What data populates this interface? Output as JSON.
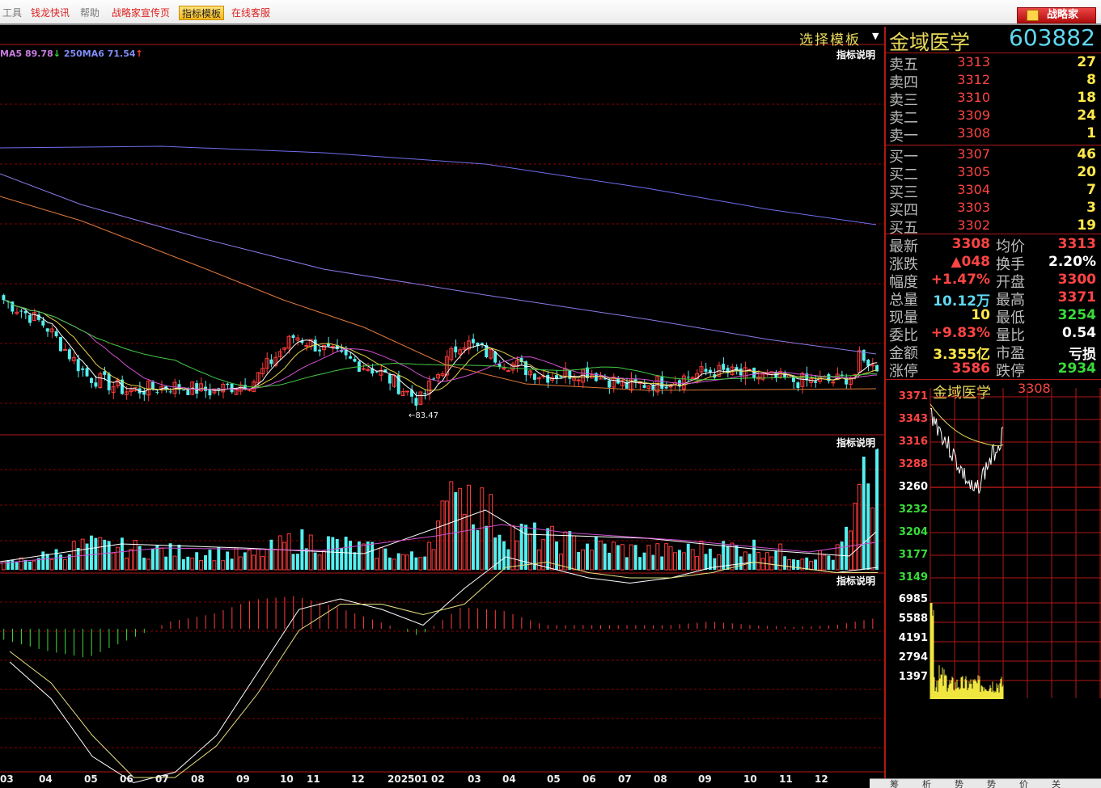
{
  "menu": {
    "tools": "工具",
    "news": "钱龙快讯",
    "help": "帮助",
    "promo": "战略家宣传页",
    "template": "指标模板",
    "service": "在线客服",
    "brand": "战略家"
  },
  "chart": {
    "template_select": "选择模板",
    "indicator_hint": "指标说明",
    "ma_legend": {
      "ma5_label": "MA5 89.78",
      "ma5_arrow": "↓",
      "ma6_label": "250MA6 71.54",
      "ma6_arrow": "↑"
    },
    "low_marker": "83.47",
    "x_labels": [
      "03",
      "04",
      "05",
      "06",
      "07",
      "08",
      "09",
      "10",
      "11",
      "12",
      "202501",
      "02",
      "03",
      "04",
      "05",
      "06",
      "07",
      "08",
      "09",
      "10",
      "11",
      "12"
    ]
  },
  "chart_data": [
    {
      "type": "candlestick",
      "title": "",
      "period": "daily",
      "x": [
        "03",
        "04",
        "05",
        "06",
        "07",
        "08",
        "09",
        "10",
        "11",
        "12",
        "202501",
        "02",
        "03",
        "04",
        "05",
        "06",
        "07",
        "08",
        "09",
        "10",
        "11",
        "12"
      ],
      "ohlc_approx": [
        {
          "x": "03",
          "open": 110,
          "high": 118,
          "low": 103,
          "close": 105
        },
        {
          "x": "04",
          "open": 105,
          "high": 108,
          "low": 95,
          "close": 100
        },
        {
          "x": "05",
          "open": 98,
          "high": 100,
          "low": 88,
          "close": 90
        },
        {
          "x": "06",
          "open": 90,
          "high": 93,
          "low": 86,
          "close": 87
        },
        {
          "x": "07",
          "open": 87,
          "high": 90,
          "low": 85,
          "close": 88
        },
        {
          "x": "08",
          "open": 88,
          "high": 90,
          "low": 86,
          "close": 87
        },
        {
          "x": "09",
          "open": 87,
          "high": 92,
          "low": 86,
          "close": 89
        },
        {
          "x": "10",
          "open": 95,
          "high": 100,
          "low": 92,
          "close": 98
        },
        {
          "x": "11",
          "open": 96,
          "high": 99,
          "low": 93,
          "close": 94
        },
        {
          "x": "12",
          "open": 94,
          "high": 96,
          "low": 90,
          "close": 91
        },
        {
          "x": "202501",
          "open": 88,
          "high": 90,
          "low": 83.47,
          "close": 85
        },
        {
          "x": "02",
          "open": 88,
          "high": 100,
          "low": 86,
          "close": 97
        },
        {
          "x": "03",
          "open": 98,
          "high": 101,
          "low": 92,
          "close": 93
        },
        {
          "x": "04",
          "open": 92,
          "high": 94,
          "low": 88,
          "close": 90
        },
        {
          "x": "05",
          "open": 90,
          "high": 92,
          "low": 88,
          "close": 91
        },
        {
          "x": "06",
          "open": 89,
          "high": 91,
          "low": 87,
          "close": 88
        },
        {
          "x": "07",
          "open": 88,
          "high": 90,
          "low": 87,
          "close": 89
        },
        {
          "x": "08",
          "open": 90,
          "high": 92,
          "low": 89,
          "close": 91
        },
        {
          "x": "09",
          "open": 91,
          "high": 94,
          "low": 89,
          "close": 90
        },
        {
          "x": "10",
          "open": 89,
          "high": 91,
          "low": 88,
          "close": 89
        },
        {
          "x": "11",
          "open": 89,
          "high": 90,
          "low": 88,
          "close": 89
        },
        {
          "x": "12",
          "open": 88,
          "high": 101,
          "low": 87,
          "close": 92
        }
      ],
      "series": [
        {
          "name": "MA5",
          "value": 89.78
        },
        {
          "name": "250MA6",
          "value": 71.54
        }
      ],
      "low_label": 83.47
    },
    {
      "type": "bar",
      "title": "",
      "x": [
        "03",
        "04",
        "05",
        "06",
        "07",
        "08",
        "09",
        "10",
        "11",
        "12",
        "202501",
        "02",
        "03",
        "04",
        "05",
        "06",
        "07",
        "08",
        "09",
        "10",
        "11",
        "12"
      ],
      "values": [
        8,
        18,
        32,
        28,
        24,
        22,
        18,
        38,
        34,
        24,
        16,
        112,
        52,
        40,
        34,
        26,
        24,
        28,
        30,
        20,
        18,
        120
      ]
    },
    {
      "type": "line",
      "title": "",
      "series": [
        {
          "values": [
            -0.4,
            -1.1,
            -2.2,
            -2.7,
            -2.5,
            -1.8,
            -0.6,
            0.6,
            0.8,
            0.6,
            0.3,
            1.0,
            1.6,
            1.4,
            1.2,
            1.1,
            1.2,
            1.4,
            1.5,
            1.4,
            1.3,
            1.4
          ]
        },
        {
          "values": [
            -0.2,
            -0.8,
            -1.8,
            -2.6,
            -2.6,
            -2.0,
            -1.0,
            0.2,
            0.7,
            0.7,
            0.5,
            0.7,
            1.4,
            1.5,
            1.3,
            1.2,
            1.2,
            1.3,
            1.5,
            1.4,
            1.3,
            1.3
          ]
        }
      ],
      "histogram": [
        -0.3,
        -0.6,
        -0.8,
        -0.3,
        0.2,
        0.4,
        0.8,
        0.9,
        0.6,
        0.2,
        -0.2,
        0.6,
        0.5,
        0.1,
        0.1,
        0.1,
        0.1,
        0.2,
        0.1,
        0.05,
        0.1,
        0.3
      ]
    },
    {
      "type": "line",
      "title": "",
      "y_ticks": [
        "3371",
        "3343",
        "3316",
        "3288",
        "3260",
        "3232",
        "3204",
        "3177",
        "3149"
      ]
    },
    {
      "type": "bar",
      "title": "",
      "y_ticks": [
        "6985",
        "5588",
        "4191",
        "2794",
        "1397"
      ]
    }
  ],
  "quote": {
    "name": "金域医学",
    "code": "603882",
    "asks": [
      {
        "label": "卖五",
        "price": "3313",
        "vol": "27"
      },
      {
        "label": "卖四",
        "price": "3312",
        "vol": "8"
      },
      {
        "label": "卖三",
        "price": "3310",
        "vol": "18"
      },
      {
        "label": "卖二",
        "price": "3309",
        "vol": "24"
      },
      {
        "label": "卖一",
        "price": "3308",
        "vol": "1"
      }
    ],
    "bids": [
      {
        "label": "买一",
        "price": "3307",
        "vol": "46"
      },
      {
        "label": "买二",
        "price": "3305",
        "vol": "20"
      },
      {
        "label": "买三",
        "price": "3304",
        "vol": "7"
      },
      {
        "label": "买四",
        "price": "3303",
        "vol": "3"
      },
      {
        "label": "买五",
        "price": "3302",
        "vol": "19"
      }
    ],
    "stats": {
      "latest_label": "最新",
      "latest": "3308",
      "avg_label": "均价",
      "avg": "3313",
      "change_label": "涨跌",
      "change": "▲048",
      "turnover_label": "换手",
      "turnover": "2.20%",
      "amplitude_label": "幅度",
      "amplitude": "+1.47%",
      "open_label": "开盘",
      "open": "3300",
      "volume_label": "总量",
      "volume": "10.12万",
      "high_label": "最高",
      "high": "3371",
      "cur_vol_label": "现量",
      "cur_vol": "10",
      "low_label": "最低",
      "low": "3254",
      "bid_ratio_label": "委比",
      "bid_ratio": "+9.83%",
      "vol_ratio_label": "量比",
      "vol_ratio": "0.54",
      "amount_label": "金额",
      "amount": "3.355亿",
      "pe_label": "市盈",
      "pe": "亏损",
      "limit_up_label": "涨停",
      "limit_up": "3586",
      "limit_down_label": "跌停",
      "limit_down": "2934"
    },
    "mini_title_name": "金域医学",
    "mini_title_price": "3308",
    "mini_price_axis": [
      "3371",
      "3343",
      "3316",
      "3288",
      "3260",
      "3232",
      "3204",
      "3177",
      "3149"
    ],
    "mini_vol_axis": [
      "6985",
      "5588",
      "4191",
      "2794",
      "1397"
    ]
  },
  "bottom_tabs": [
    "筹",
    "析",
    "势",
    "势",
    "价",
    "关"
  ],
  "colors": {
    "up": "#ff3b3b",
    "down": "#55f0f0",
    "grid": "#8a0000",
    "price_text": "#ff4444",
    "name_text": "#e8d95a",
    "code_text": "#5fd8f0"
  }
}
